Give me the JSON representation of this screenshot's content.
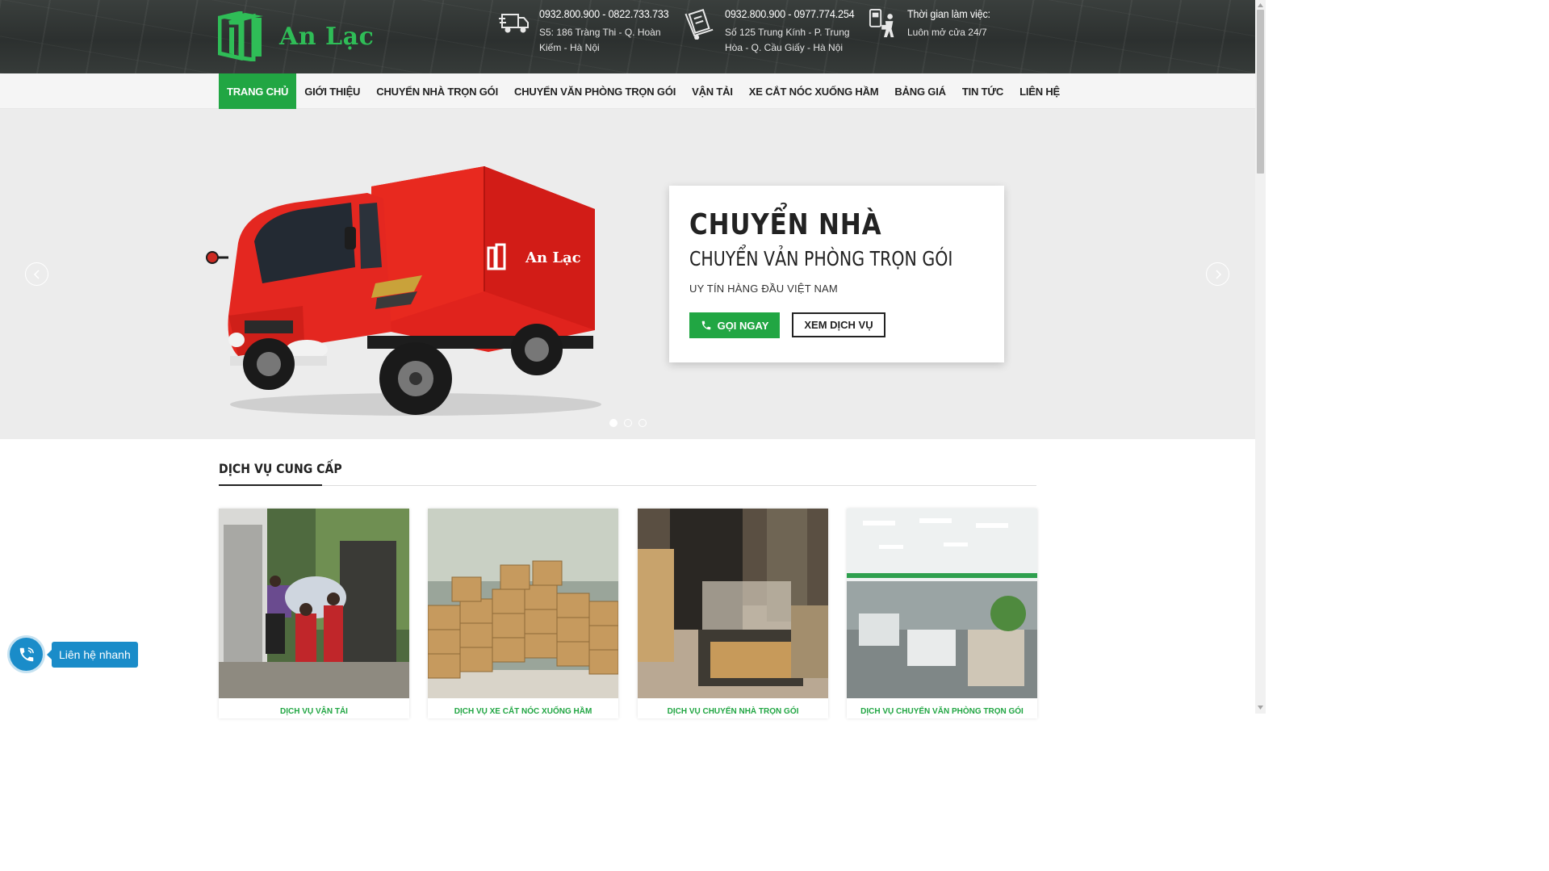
{
  "brand": {
    "name": "An Lạc",
    "accent_color": "#21a643",
    "logo_color": "#2fbd57"
  },
  "header": {
    "contacts": [
      {
        "icon": "moving-truck-icon",
        "phones": "0932.800.900 - 0822.733.733",
        "address_line1": "S5: 186 Tràng Thi - Q. Hoàn",
        "address_line2": "Kiếm - Hà Nội"
      },
      {
        "icon": "hand-truck-icon",
        "phones": "0932.800.900 - 0977.774.254",
        "address_line1": "Số 125 Trung Kính - P. Trung",
        "address_line2": "Hòa - Q. Cầu Giấy - Hà Nội"
      },
      {
        "icon": "working-hours-icon",
        "title": "Thời gian làm việc:",
        "note": "Luôn mở cửa 24/7"
      }
    ]
  },
  "nav": {
    "items": [
      {
        "label": "TRANG CHỦ",
        "active": true
      },
      {
        "label": "GIỚI THIỆU"
      },
      {
        "label": "CHUYỂN NHÀ TRỌN GÓI"
      },
      {
        "label": "CHUYỂN VĂN PHÒNG TRỌN GÓI"
      },
      {
        "label": "VẬN TẢI"
      },
      {
        "label": "XE CẮT NÓC XUỐNG HẦM"
      },
      {
        "label": "BẢNG GIÁ"
      },
      {
        "label": "TIN TỨC"
      },
      {
        "label": "LIÊN HỆ"
      }
    ]
  },
  "hero": {
    "title": "CHUYỂN NHÀ",
    "subtitle": "CHUYỂN VẢN PHÒNG TRỌN GÓI",
    "tagline": "UY TÍN HÀNG ĐẦU VIỆT NAM",
    "call_button": "GỌI NGAY",
    "service_button": "XEM DỊCH VỤ",
    "truck_brand": "An Lạc",
    "slide_count": 3,
    "active_slide": 1
  },
  "services": {
    "title": "DỊCH VỤ CUNG CẤP",
    "cards": [
      {
        "caption": "DỊCH VỤ VẬN TẢI"
      },
      {
        "caption": "DỊCH VỤ XE CẮT NÓC XUỐNG HẦM"
      },
      {
        "caption": "DỊCH VỤ CHUYỂN NHÀ TRỌN GÓI"
      },
      {
        "caption": "DỊCH VỤ CHUYỂN VĂN PHÒNG TRỌN GÓI"
      }
    ]
  },
  "quick_contact": {
    "label": "Liên hệ nhanh",
    "icon": "phone-icon"
  }
}
